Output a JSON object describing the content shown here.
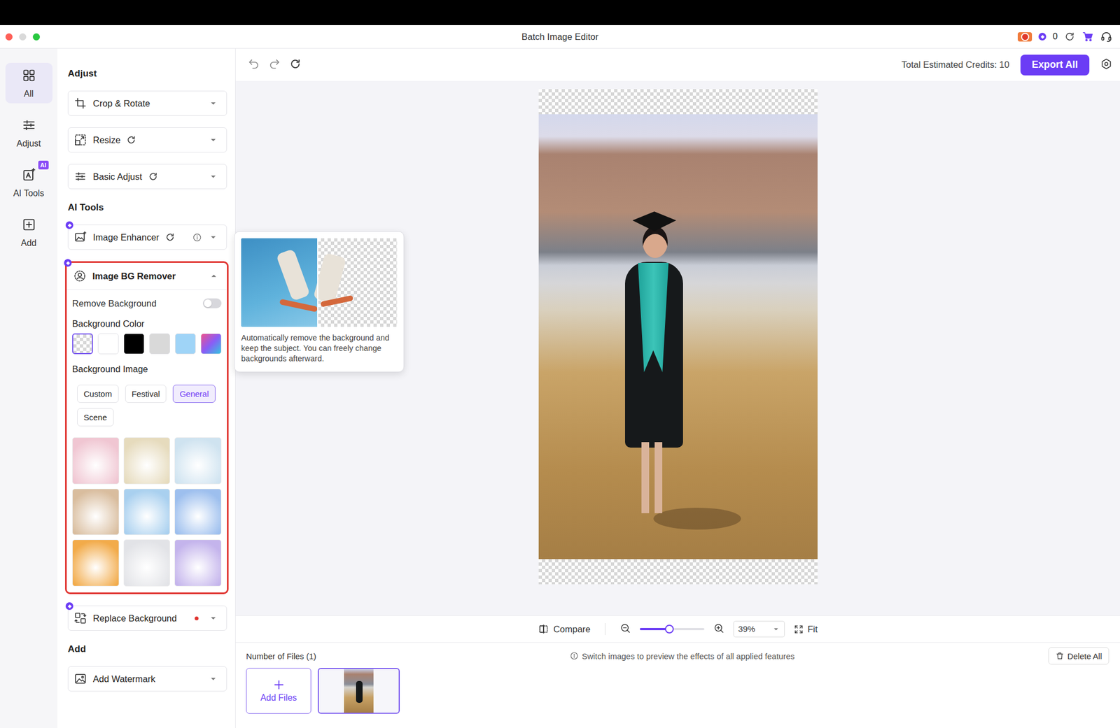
{
  "window": {
    "title": "Batch Image Editor"
  },
  "titlebar": {
    "credits": "0"
  },
  "nav": [
    {
      "label": "All",
      "selected": true,
      "icon": "grid"
    },
    {
      "label": "Adjust",
      "selected": false,
      "icon": "sliders"
    },
    {
      "label": "AI Tools",
      "selected": false,
      "icon": "ai",
      "badge": "AI"
    },
    {
      "label": "Add",
      "selected": false,
      "icon": "plusbox"
    }
  ],
  "sections": [
    {
      "title": "Adjust",
      "tools": [
        {
          "label": "Crop & Rotate",
          "icon": "crop",
          "ai": false,
          "reset": false,
          "info": false,
          "dot": false,
          "expanded": false
        },
        {
          "label": "Resize",
          "icon": "resize",
          "ai": false,
          "reset": true,
          "info": false,
          "dot": false,
          "expanded": false
        },
        {
          "label": "Basic Adjust",
          "icon": "sliders",
          "ai": false,
          "reset": true,
          "info": false,
          "dot": false,
          "expanded": false
        }
      ]
    },
    {
      "title": "AI Tools",
      "tools": [
        {
          "label": "Image Enhancer",
          "icon": "enhance",
          "ai": true,
          "reset": true,
          "info": true,
          "dot": false,
          "expanded": false
        },
        {
          "label": "Image BG Remover",
          "icon": "bgremove",
          "ai": true,
          "reset": false,
          "info": false,
          "dot": false,
          "expanded": true
        },
        {
          "label": "Replace Background",
          "icon": "replace",
          "ai": true,
          "reset": false,
          "info": false,
          "dot": true,
          "color": "#e0332f",
          "expanded": false
        }
      ]
    },
    {
      "title": "Add",
      "tools": [
        {
          "label": "Add Watermark",
          "icon": "watermark",
          "ai": false,
          "reset": false,
          "info": false,
          "dot": false,
          "expanded": false
        }
      ]
    }
  ],
  "bg_remover": {
    "toggle": {
      "label": "Remove Background",
      "on": false
    },
    "color_label": "Background Color",
    "colors": [
      {
        "kind": "transparent",
        "color": "#ffffff",
        "selected": true
      },
      {
        "kind": "solid",
        "color": "#ffffff",
        "selected": false
      },
      {
        "kind": "solid",
        "color": "#000000",
        "selected": false
      },
      {
        "kind": "solid",
        "color": "#d9d9d9",
        "selected": false
      },
      {
        "kind": "solid",
        "color": "#9fd4f7",
        "selected": false
      },
      {
        "kind": "gradient",
        "color": "#8a5cf6",
        "selected": false
      }
    ],
    "image_label": "Background Image",
    "categories": [
      {
        "label": "Custom",
        "selected": false
      },
      {
        "label": "Festival",
        "selected": false
      },
      {
        "label": "General",
        "selected": true
      },
      {
        "label": "Scene",
        "selected": false
      }
    ],
    "thumbnails": [
      {
        "color": "#f0c6d2"
      },
      {
        "color": "#e6dbbd"
      },
      {
        "color": "#cfe3f0"
      },
      {
        "color": "#d9bd9e"
      },
      {
        "color": "#a9d0ef"
      },
      {
        "color": "#9dbfee"
      },
      {
        "color": "#f2ab4a"
      },
      {
        "color": "#e2e3e7"
      },
      {
        "color": "#c4b4ec"
      }
    ]
  },
  "tooltip": {
    "text": "Automatically remove the background and keep the subject. You can freely change backgrounds afterward."
  },
  "toolbar": {
    "credits": "Total Estimated Credits: 10",
    "export": "Export All"
  },
  "zoom": {
    "compare": "Compare",
    "level": 0.46,
    "reading": "39%",
    "fit": "Fit"
  },
  "files": {
    "count": "Number of Files (1)",
    "hint": "Switch images to preview the effects of all applied features",
    "delete": "Delete All",
    "add": "Add Files",
    "items": [
      {
        "selected": true
      }
    ]
  }
}
